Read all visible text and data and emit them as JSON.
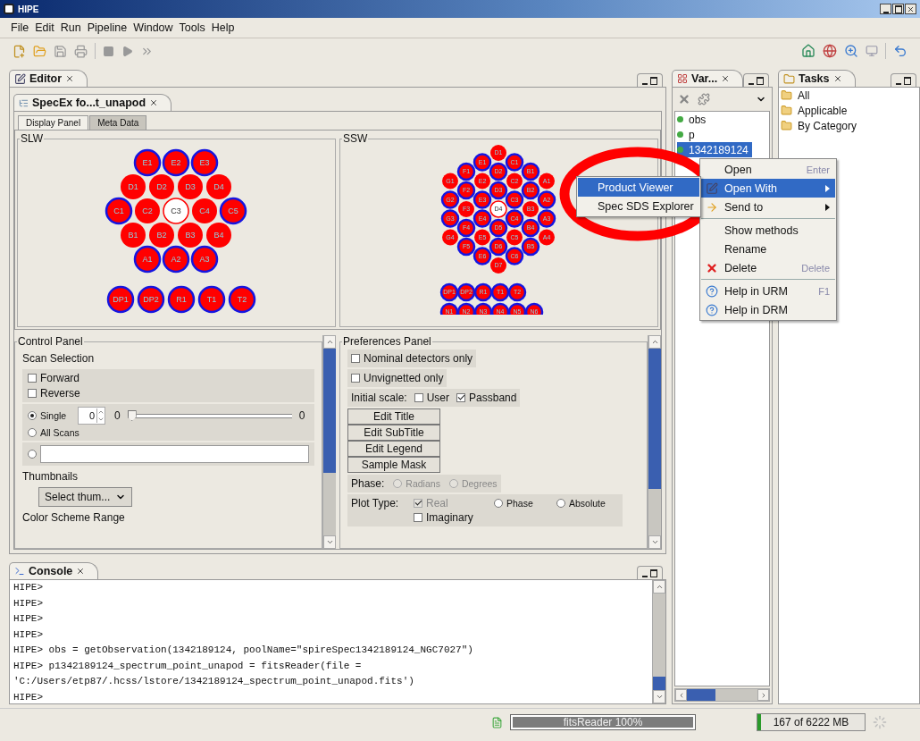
{
  "window": {
    "title": "HIPE"
  },
  "menu_bar": [
    "File",
    "Edit",
    "Run",
    "Pipeline",
    "Window",
    "Tools",
    "Help"
  ],
  "editor": {
    "tab": {
      "label": "Editor",
      "selected": true
    },
    "document_tab": {
      "label": "SpecEx fo...t_unapod",
      "selected": true
    },
    "display_tabs": [
      {
        "label": "Display Panel",
        "selected": true
      },
      {
        "label": "Meta Data",
        "selected": false
      }
    ],
    "arrays": [
      {
        "title": "SLW",
        "kind": "rows",
        "groups": [
          [
            {
              "label": "E1",
              "outlined": true,
              "selected": false
            },
            {
              "label": "E2",
              "outlined": true,
              "selected": false
            },
            {
              "label": "E3",
              "outlined": true,
              "selected": false
            }
          ],
          [
            {
              "label": "D1",
              "outlined": false,
              "selected": false
            },
            {
              "label": "D2",
              "outlined": false,
              "selected": false
            },
            {
              "label": "D3",
              "outlined": false,
              "selected": false
            },
            {
              "label": "D4",
              "outlined": false,
              "selected": false
            }
          ],
          [
            {
              "label": "C1",
              "outlined": true,
              "selected": false
            },
            {
              "label": "C2",
              "outlined": false,
              "selected": false
            },
            {
              "label": "C3",
              "outlined": false,
              "selected": true
            },
            {
              "label": "C4",
              "outlined": false,
              "selected": false
            },
            {
              "label": "C5",
              "outlined": true,
              "selected": false
            }
          ],
          [
            {
              "label": "B1",
              "outlined": false,
              "selected": false
            },
            {
              "label": "B2",
              "outlined": false,
              "selected": false
            },
            {
              "label": "B3",
              "outlined": false,
              "selected": false
            },
            {
              "label": "B4",
              "outlined": false,
              "selected": false
            }
          ],
          [
            {
              "label": "A1",
              "outlined": true,
              "selected": false
            },
            {
              "label": "A2",
              "outlined": true,
              "selected": false
            },
            {
              "label": "A3",
              "outlined": true,
              "selected": false
            }
          ]
        ],
        "extras": [
          [
            {
              "label": "DP1",
              "outlined": true,
              "selected": false
            },
            {
              "label": "DP2",
              "outlined": true,
              "selected": false
            },
            {
              "label": "R1",
              "outlined": true,
              "selected": false
            },
            {
              "label": "T1",
              "outlined": true,
              "selected": false
            },
            {
              "label": "T2",
              "outlined": true,
              "selected": false
            }
          ]
        ]
      },
      {
        "title": "SSW",
        "kind": "columns",
        "groups": [
          [
            {
              "label": "G1",
              "outlined": false,
              "selected": false
            },
            {
              "label": "G2",
              "outlined": true,
              "selected": false
            },
            {
              "label": "G3",
              "outlined": true,
              "selected": false
            },
            {
              "label": "G4",
              "outlined": false,
              "selected": false
            }
          ],
          [
            {
              "label": "F1",
              "outlined": true,
              "selected": false
            },
            {
              "label": "F2",
              "outlined": true,
              "selected": false
            },
            {
              "label": "F3",
              "outlined": false,
              "selected": false
            },
            {
              "label": "F4",
              "outlined": true,
              "selected": false
            },
            {
              "label": "F5",
              "outlined": true,
              "selected": false
            }
          ],
          [
            {
              "label": "E1",
              "outlined": true,
              "selected": false
            },
            {
              "label": "E2",
              "outlined": false,
              "selected": false
            },
            {
              "label": "E3",
              "outlined": true,
              "selected": false
            },
            {
              "label": "E4",
              "outlined": true,
              "selected": false
            },
            {
              "label": "E5",
              "outlined": false,
              "selected": false
            },
            {
              "label": "E6",
              "outlined": true,
              "selected": false
            }
          ],
          [
            {
              "label": "D1",
              "outlined": false,
              "selected": false
            },
            {
              "label": "D2",
              "outlined": true,
              "selected": false
            },
            {
              "label": "D3",
              "outlined": true,
              "selected": false
            },
            {
              "label": "D4",
              "outlined": false,
              "selected": true
            },
            {
              "label": "D5",
              "outlined": true,
              "selected": false
            },
            {
              "label": "D6",
              "outlined": true,
              "selected": false
            },
            {
              "label": "D7",
              "outlined": false,
              "selected": false
            }
          ],
          [
            {
              "label": "C1",
              "outlined": true,
              "selected": false
            },
            {
              "label": "C2",
              "outlined": false,
              "selected": false
            },
            {
              "label": "C3",
              "outlined": true,
              "selected": false
            },
            {
              "label": "C4",
              "outlined": true,
              "selected": false
            },
            {
              "label": "C5",
              "outlined": false,
              "selected": false
            },
            {
              "label": "C6",
              "outlined": true,
              "selected": false
            }
          ],
          [
            {
              "label": "B1",
              "outlined": true,
              "selected": false
            },
            {
              "label": "B2",
              "outlined": true,
              "selected": false
            },
            {
              "label": "B3",
              "outlined": false,
              "selected": false
            },
            {
              "label": "B4",
              "outlined": true,
              "selected": false
            },
            {
              "label": "B5",
              "outlined": true,
              "selected": false
            }
          ],
          [
            {
              "label": "A1",
              "outlined": false,
              "selected": false
            },
            {
              "label": "A2",
              "outlined": true,
              "selected": false
            },
            {
              "label": "A3",
              "outlined": true,
              "selected": false
            },
            {
              "label": "A4",
              "outlined": false,
              "selected": false
            }
          ]
        ],
        "extras": [
          [
            {
              "label": "DP1",
              "outlined": true,
              "selected": false
            },
            {
              "label": "DP2",
              "outlined": true,
              "selected": false
            },
            {
              "label": "R1",
              "outlined": true,
              "selected": false
            },
            {
              "label": "T1",
              "outlined": true,
              "selected": false
            },
            {
              "label": "T2",
              "outlined": true,
              "selected": false
            }
          ],
          [
            {
              "label": "N1",
              "outlined": true,
              "selected": false
            },
            {
              "label": "N2",
              "outlined": true,
              "selected": false
            },
            {
              "label": "N3",
              "outlined": true,
              "selected": false
            },
            {
              "label": "N4",
              "outlined": true,
              "selected": false
            },
            {
              "label": "N5",
              "outlined": true,
              "selected": false
            },
            {
              "label": "N6",
              "outlined": true,
              "selected": false
            }
          ]
        ]
      }
    ],
    "control_panel": {
      "title": "Control Panel",
      "scan_heading": "Scan Selection",
      "directions": [
        {
          "label": "Forward",
          "checked": false
        },
        {
          "label": "Reverse",
          "checked": false
        }
      ],
      "single": {
        "label": "Single",
        "selected": true,
        "value": "0",
        "min": "0",
        "max": "0",
        "level": 0
      },
      "all_scans": {
        "label": "All Scans",
        "selected": false
      },
      "custom": {
        "selected": false
      },
      "thumbnails_heading": "Thumbnails",
      "thumbnails_select": "Select thum...",
      "color_heading": "Color Scheme Range"
    },
    "preferences_panel": {
      "title": "Preferences Panel",
      "options": [
        {
          "label": "Nominal detectors only",
          "checked": false
        },
        {
          "label": "Unvignetted only",
          "checked": false
        }
      ],
      "scale_label": "Initial scale:",
      "scale_options": [
        {
          "label": "User",
          "checked": false
        },
        {
          "label": "Passband",
          "checked": true
        }
      ],
      "buttons": [
        "Edit Title",
        "Edit SubTitle",
        "Edit Legend",
        "Sample Mask"
      ],
      "phase_label": "Phase:",
      "phase_options": [
        {
          "label": "Radians",
          "selected": false,
          "disabled": true
        },
        {
          "label": "Degrees",
          "selected": false,
          "disabled": true
        }
      ],
      "plot_label": "Plot Type:",
      "plot_options": [
        {
          "kind": "checkbox",
          "label": "Real",
          "checked": true,
          "disabled": true
        },
        {
          "kind": "radio",
          "label": "Phase",
          "selected": false,
          "disabled": false
        },
        {
          "kind": "radio",
          "label": "Absolute",
          "selected": false,
          "disabled": false
        },
        {
          "kind": "checkbox",
          "label": "Imaginary",
          "checked": false,
          "disabled": false
        }
      ]
    }
  },
  "console": {
    "tab": {
      "label": "Console",
      "selected": true
    },
    "lines": [
      "HIPE>",
      "HIPE>",
      "HIPE>",
      "HIPE>",
      "HIPE> obs = getObservation(1342189124, poolName=\"spireSpec1342189124_NGC7027\")",
      "HIPE> p1342189124_spectrum_point_unapod = fitsReader(file =",
      "'C:/Users/etp87/.hcss/lstore/1342189124_spectrum_point_unapod.fits')",
      "HIPE>"
    ]
  },
  "variables": {
    "tab": {
      "label": "Var...",
      "selected": true
    },
    "items": [
      {
        "name": "obs",
        "selected": false
      },
      {
        "name": "p",
        "selected": false
      },
      {
        "name": "1342189124",
        "selected": true
      }
    ]
  },
  "tasks": {
    "tab": {
      "label": "Tasks",
      "selected": true
    },
    "items": [
      "All",
      "Applicable",
      "By Category"
    ]
  },
  "context_menu": {
    "items": [
      {
        "kind": "item",
        "label": "Open",
        "shortcut": "Enter",
        "selected": false
      },
      {
        "kind": "submenu",
        "label": "Open With",
        "selected": true
      },
      {
        "kind": "submenu",
        "label": "Send to",
        "selected": false
      },
      {
        "kind": "separator"
      },
      {
        "kind": "item",
        "label": "Show methods",
        "selected": false
      },
      {
        "kind": "item",
        "label": "Rename",
        "selected": false
      },
      {
        "kind": "item",
        "label": "Delete",
        "shortcut": "Delete",
        "selected": false
      },
      {
        "kind": "separator"
      },
      {
        "kind": "item",
        "label": "Help in URM",
        "shortcut": "F1",
        "selected": false
      },
      {
        "kind": "item",
        "label": "Help in DRM",
        "selected": false
      }
    ]
  },
  "submenu": {
    "items": [
      {
        "label": "Product Viewer",
        "selected": true
      },
      {
        "label": "Spec SDS Explorer",
        "selected": false
      }
    ]
  },
  "status_bar": {
    "task": {
      "label": "fitsReader 100%",
      "level": 1
    },
    "memory": {
      "label": "167 of 6222 MB",
      "level": 0.03
    }
  }
}
